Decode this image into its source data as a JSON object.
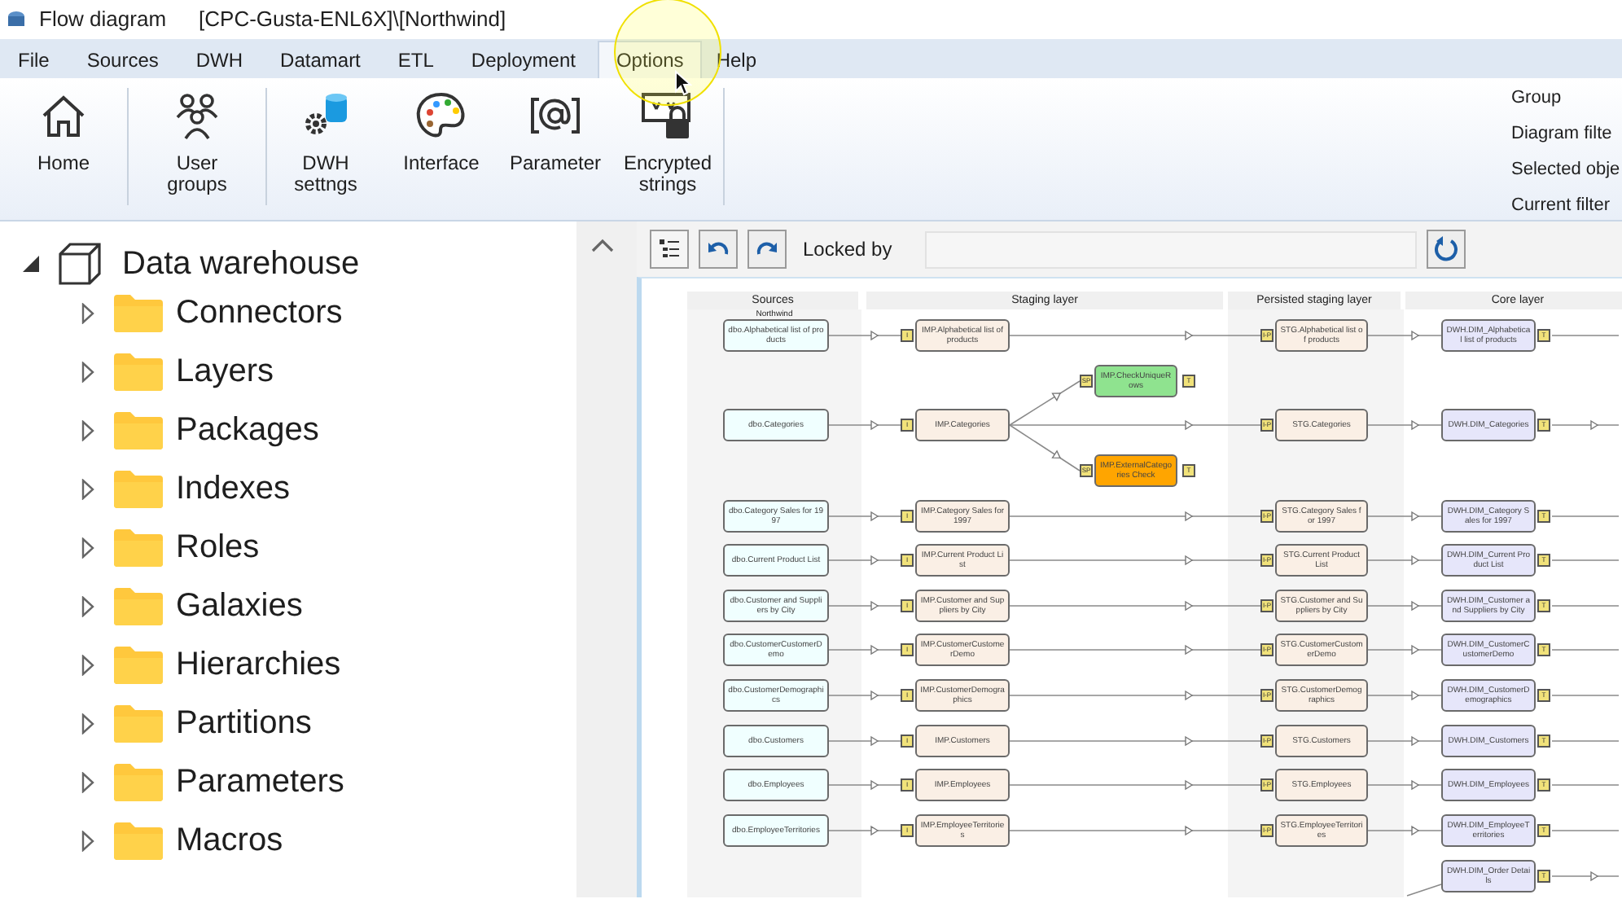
{
  "window": {
    "title": "Flow diagram",
    "path": "[CPC-Gusta-ENL6X]\\[Northwind]"
  },
  "menu": [
    {
      "label": "File",
      "selected": false
    },
    {
      "label": "Sources",
      "selected": false
    },
    {
      "label": "DWH",
      "selected": false
    },
    {
      "label": "Datamart",
      "selected": false
    },
    {
      "label": "ETL",
      "selected": false
    },
    {
      "label": "Deployment",
      "selected": false
    },
    {
      "label": "Options",
      "selected": true
    },
    {
      "label": "Help",
      "selected": false
    }
  ],
  "ribbon": {
    "buttons": [
      {
        "kind": "home",
        "label": "Home",
        "separator_after": true
      },
      {
        "kind": "users",
        "label": "User groups",
        "separator_after": true
      },
      {
        "kind": "dwh",
        "label": "DWH settngs",
        "separator_after": false
      },
      {
        "kind": "palette",
        "label": "Interface",
        "separator_after": false
      },
      {
        "kind": "parameter",
        "label": "Parameter",
        "separator_after": false
      },
      {
        "kind": "encrypted",
        "label": "Encrypted strings",
        "separator_after": true
      }
    ],
    "side_labels": [
      "Group",
      "Diagram filte",
      "Selected obje",
      "Current filter"
    ]
  },
  "tree": {
    "label": "Data warehouse",
    "expanded": true,
    "children": [
      {
        "label": "Connectors",
        "expanded": false
      },
      {
        "label": "Layers",
        "expanded": false
      },
      {
        "label": "Packages",
        "expanded": false
      },
      {
        "label": "Indexes",
        "expanded": false
      },
      {
        "label": "Roles",
        "expanded": false
      },
      {
        "label": "Galaxies",
        "expanded": false
      },
      {
        "label": "Hierarchies",
        "expanded": false
      },
      {
        "label": "Partitions",
        "expanded": false
      },
      {
        "label": "Parameters",
        "expanded": false
      },
      {
        "label": "Macros",
        "expanded": false
      }
    ]
  },
  "toolbar": {
    "locked_by_label": "Locked by"
  },
  "diagram": {
    "lanes": [
      {
        "title": "Sources",
        "subtitle": "Northwind"
      },
      {
        "title": "Staging layer"
      },
      {
        "title": "Persisted staging layer"
      },
      {
        "title": "Core layer"
      }
    ],
    "rows": [
      {
        "source": "dbo.Alphabetical list of products",
        "staging": {
          "label": "IMP.Alphabetical list of products",
          "flag": "I"
        },
        "persisted": {
          "label": "STG.Alphabetical list of products",
          "flag": "I-P"
        },
        "core": {
          "label": "DWH.DIM_Alphabetical list of products",
          "flag": "T"
        },
        "outgoing_arrow": false
      },
      {
        "source": "dbo.Categories",
        "staging": {
          "label": "IMP.Categories",
          "flag": "I"
        },
        "persisted": {
          "label": "STG.Categories",
          "flag": "I-P"
        },
        "core": {
          "label": "DWH.DIM_Categories",
          "flag": "T"
        },
        "outgoing_arrow": true,
        "branches": [
          {
            "label": "IMP.CheckUniqueRows",
            "flag": "SP",
            "end_flag": "T",
            "color": "#8fe38f"
          },
          {
            "label": "IMP.ExternalCategories Check",
            "flag": "SP",
            "end_flag": "T",
            "color": "#ffa500"
          }
        ]
      },
      {
        "source": "dbo.Category Sales for 1997",
        "staging": {
          "label": "IMP.Category Sales for 1997",
          "flag": "I"
        },
        "persisted": {
          "label": "STG.Category Sales for 1997",
          "flag": "I-P"
        },
        "core": {
          "label": "DWH.DIM_Category Sales for 1997",
          "flag": "T"
        },
        "outgoing_arrow": false
      },
      {
        "source": "dbo.Current Product List",
        "staging": {
          "label": "IMP.Current Product List",
          "flag": "I"
        },
        "persisted": {
          "label": "STG.Current Product List",
          "flag": "I-P"
        },
        "core": {
          "label": "DWH.DIM_Current Product List",
          "flag": "T"
        },
        "outgoing_arrow": false
      },
      {
        "source": "dbo.Customer and Suppliers by City",
        "staging": {
          "label": "IMP.Customer and Suppliers by City",
          "flag": "I"
        },
        "persisted": {
          "label": "STG.Customer and Suppliers by City",
          "flag": "I-P"
        },
        "core": {
          "label": "DWH.DIM_Customer and Suppliers by City",
          "flag": "T"
        },
        "outgoing_arrow": false
      },
      {
        "source": "dbo.CustomerCustomerDemo",
        "staging": {
          "label": "IMP.CustomerCustomerDemo",
          "flag": "I"
        },
        "persisted": {
          "label": "STG.CustomerCustomerDemo",
          "flag": "I-P"
        },
        "core": {
          "label": "DWH.DIM_CustomerCustomerDemo",
          "flag": "T"
        },
        "outgoing_arrow": false
      },
      {
        "source": "dbo.CustomerDemographics",
        "staging": {
          "label": "IMP.CustomerDemographics",
          "flag": "I"
        },
        "persisted": {
          "label": "STG.CustomerDemographics",
          "flag": "I-P"
        },
        "core": {
          "label": "DWH.DIM_CustomerDemographics",
          "flag": "T"
        },
        "outgoing_arrow": false
      },
      {
        "source": "dbo.Customers",
        "staging": {
          "label": "IMP.Customers",
          "flag": "I"
        },
        "persisted": {
          "label": "STG.Customers",
          "flag": "I-P"
        },
        "core": {
          "label": "DWH.DIM_Customers",
          "flag": "T"
        },
        "outgoing_arrow": false
      },
      {
        "source": "dbo.Employees",
        "staging": {
          "label": "IMP.Employees",
          "flag": "I"
        },
        "persisted": {
          "label": "STG.Employees",
          "flag": "I-P"
        },
        "core": {
          "label": "DWH.DIM_Employees",
          "flag": "T"
        },
        "outgoing_arrow": false
      },
      {
        "source": "dbo.EmployeeTerritories",
        "staging": {
          "label": "IMP.EmployeeTerritories",
          "flag": "I"
        },
        "persisted": {
          "label": "STG.EmployeeTerritories",
          "flag": "I-P"
        },
        "core": {
          "label": "DWH.DIM_EmployeeTerritories",
          "flag": "T"
        },
        "outgoing_arrow": false
      },
      {
        "core": {
          "label": "DWH.DIM_Order Details",
          "flag": "T"
        },
        "outgoing_arrow": true
      }
    ]
  }
}
